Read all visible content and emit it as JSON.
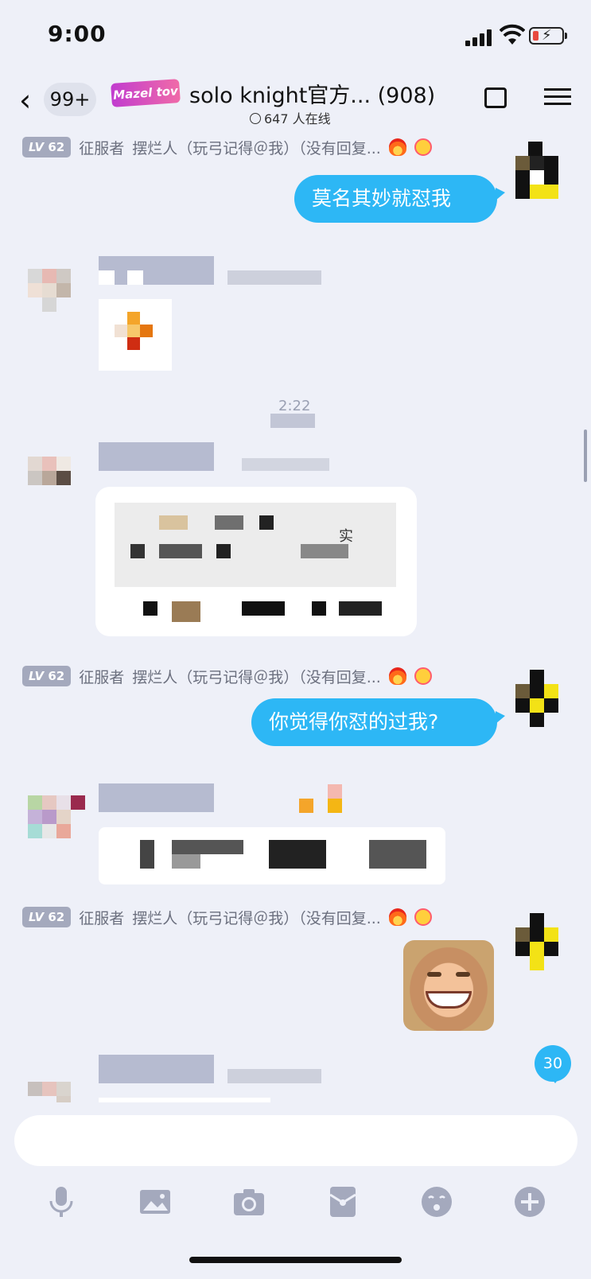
{
  "status_bar": {
    "time": "9:00"
  },
  "nav": {
    "back_count": "99+",
    "logo_text": "Mazel tov",
    "group_title": "solo knight官方... (908)",
    "online": "647 人在线"
  },
  "messages": [
    {
      "sender_level": "62",
      "sender_title": "征服者",
      "sender_name": "摆烂人（玩弓记得＠我）（没有回复...",
      "text": "莫名其妙就怼我"
    },
    {
      "sender_level": "62",
      "sender_title": "征服者",
      "sender_name": "摆烂人（玩弓记得＠我）（没有回复...",
      "text": "你觉得你怼的过我?"
    },
    {
      "sender_level": "62",
      "sender_title": "征服者",
      "sender_name": "摆烂人（玩弓记得＠我）（没有回复...",
      "sticker": "smiling-face-sticker"
    }
  ],
  "timestamp_fragment": "2:22",
  "blurred_text_fragment": "实",
  "unread_count": "30",
  "toolbar": [
    "mic-icon",
    "image-icon",
    "camera-icon",
    "red-packet-icon",
    "emoji-icon",
    "plus-icon"
  ],
  "colors": {
    "bubble_blue": "#2db7f5",
    "background": "#eef0f8",
    "level_badge": "#a4a9bd"
  }
}
